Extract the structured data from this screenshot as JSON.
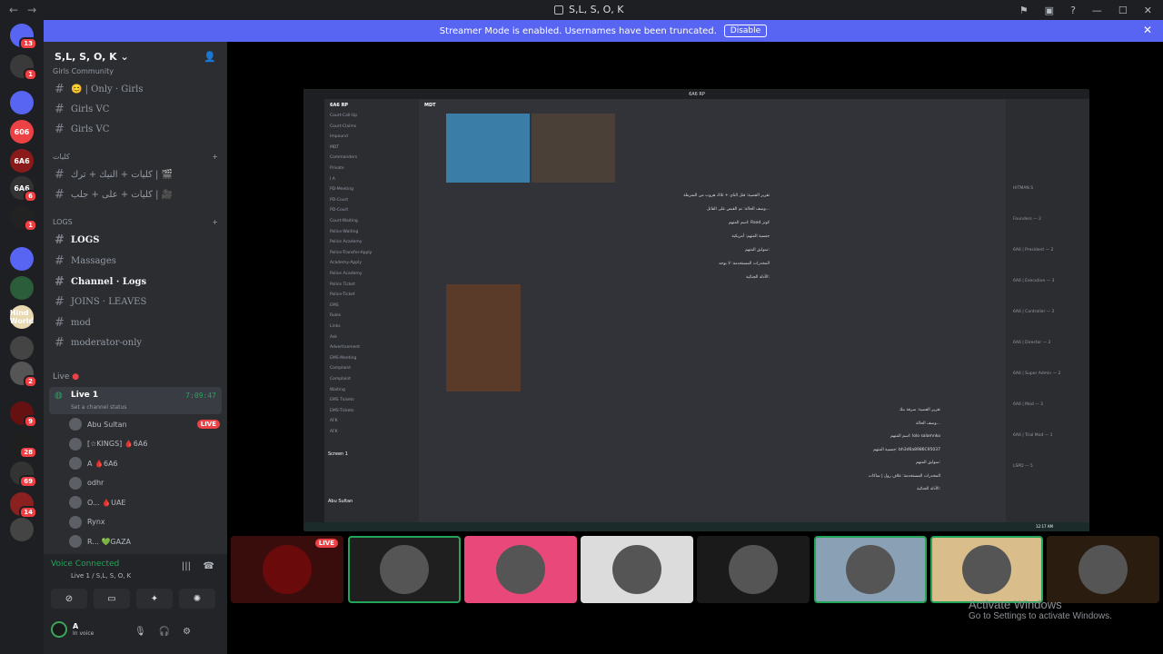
{
  "window": {
    "title": "S,L, S, O, K"
  },
  "banner": {
    "text": "Streamer Mode is enabled. Usernames have been truncated.",
    "disable_label": "Disable"
  },
  "servers": [
    {
      "label": "",
      "badge": "13",
      "color": "#5865f2"
    },
    {
      "label": "",
      "badge": "1",
      "color": "#3a3a3a"
    },
    {
      "label": "",
      "badge": "",
      "color": "#5865f2"
    },
    {
      "label": "606",
      "badge": "",
      "color": "#ed4245"
    },
    {
      "label": "6A6",
      "badge": "",
      "color": "#8b1a1a"
    },
    {
      "label": "6A6",
      "badge": "6",
      "color": "#333333"
    },
    {
      "label": "",
      "badge": "1",
      "color": "#222222"
    },
    {
      "label": "",
      "badge": "",
      "color": "#5865f2"
    },
    {
      "label": "",
      "badge": "",
      "color": "#2b5d3a"
    },
    {
      "label": "Hind World",
      "badge": "",
      "color": "#e8d9b0"
    },
    {
      "label": "",
      "badge": "",
      "color": "#444444"
    },
    {
      "label": "",
      "badge": "2",
      "color": "#555555"
    },
    {
      "label": "",
      "badge": "9",
      "color": "#661111"
    },
    {
      "label": "",
      "badge": "28",
      "color": "#1f1f1f"
    },
    {
      "label": "",
      "badge": "69",
      "color": "#333333"
    },
    {
      "label": "",
      "badge": "14",
      "color": "#8b2020"
    },
    {
      "label": "",
      "badge": "",
      "color": "#444444"
    }
  ],
  "sidebar": {
    "server_name": "S,L, S, O, K",
    "top_partial": "Girls Community",
    "channels_top": [
      {
        "name": "😊 | Only · Girls"
      },
      {
        "name": "Girls VC"
      },
      {
        "name": "Girls VC"
      }
    ],
    "cat1": "كليات",
    "channels_cat1": [
      {
        "name": "كليات + النيك + ترك | 🎬"
      },
      {
        "name": "كليات + على + جلب | 🎥"
      }
    ],
    "cat_logs": "LOGS",
    "logs": [
      {
        "name": "LOGS",
        "bold": true
      },
      {
        "name": "Massages",
        "bold": false
      },
      {
        "name": "Channel · Logs",
        "bold": true
      },
      {
        "name": "JOINS · LEAVES",
        "bold": false
      },
      {
        "name": "mod",
        "bold": false
      },
      {
        "name": "moderator-only",
        "bold": false
      }
    ],
    "cat_live": "Live",
    "voice_channel": {
      "name": "Live 1",
      "time": "7:09:47",
      "status": "Set a channel status"
    },
    "voice_users": [
      {
        "name": "Abu Sultan",
        "live": "LIVE"
      },
      {
        "name": "[☆KINGS]  🩸6A6",
        "live": ""
      },
      {
        "name": "A  🩸6A6",
        "live": ""
      },
      {
        "name": "odhr",
        "live": ""
      },
      {
        "name": "O...  🩸UAE",
        "live": ""
      },
      {
        "name": "Rynx",
        "live": ""
      },
      {
        "name": "R...  💚GAZA",
        "live": ""
      }
    ]
  },
  "voice_panel": {
    "status": "Voice Connected",
    "channel": "Live 1 / S,L, S, O, K"
  },
  "user": {
    "name": "A",
    "status": "In voice"
  },
  "stream": {
    "app_title": "6A6 RP",
    "server": "6A6 RP",
    "channel": "MDT",
    "channels": [
      "Court-Call-Up",
      "Court-Claims",
      "Impound",
      "MDT",
      "Commanders",
      "Private",
      "I A",
      "PD-Meeting",
      "PD-Court",
      "PD-Court",
      "Court-Waiting",
      "Police-Waiting",
      "Police Academy",
      "Police-Transfer-Apply",
      "Academy-Apply",
      "Police Academy",
      "Police Ticket",
      "Police-Ticket",
      "EMS",
      "Rules",
      "Links",
      "Ask",
      "Advertisement",
      "EMS-Meeting",
      "Complaint",
      "Complaint",
      "Waiting",
      "EMS Tickets",
      "EMS-Tickets",
      "AFK",
      "AFK"
    ],
    "chat_lines": [
      "تقرير القضية: قتل الناي + تلاك هروب من الشرطة",
      "وصف الحالة: تم القبض على القاتل...",
      "اسم المتهم: Raad كوتر",
      "جنسية المتهم: أمريكية",
      "سوابق المتهم:",
      "المخدرات المستخدمة: لا يوجد",
      "الأدلة الجنائية:"
    ],
    "chat_lines_2": [
      "تقرير القضية: سرقة بنك",
      "وصف الحالة...",
      "اسم المتهم: lolo salamnko",
      "جنسية المتهم: bh3d6a8986C95037",
      "سوابق المتهم:",
      "المخدرات المستخدمة: غلاف رول | شاكات",
      "الأدلة الجنائية:"
    ],
    "members": [
      "HITMAN.S",
      "Founders — 2",
      "6A6 | President — 2",
      "6A6 | Executive — 3",
      "6A6 | Controller — 2",
      "6A6 | Director — 2",
      "6A6 | Super Admin — 2",
      "6A6 | Mod — 3",
      "6A6 | Trial Mod — 1",
      "LSPD — 5"
    ],
    "screen_label": "Screen 1",
    "stream_user": "Abu Sultan",
    "taskbar_time": "12:17 AM"
  },
  "tiles": [
    {
      "name": "stream",
      "live": "LIVE",
      "bg": "#3a0d0d"
    },
    {
      "name": "user-1",
      "live": "",
      "bg": "#1f1f1f"
    },
    {
      "name": "user-2",
      "live": "",
      "bg": "#e8487a"
    },
    {
      "name": "user-3",
      "live": "",
      "bg": "#dcdcdc"
    },
    {
      "name": "user-4",
      "live": "",
      "bg": "#1a1a1a"
    },
    {
      "name": "user-5",
      "live": "",
      "bg": "#8aa0b4"
    },
    {
      "name": "user-6",
      "live": "",
      "bg": "#d9bd8b"
    },
    {
      "name": "user-7",
      "live": "",
      "bg": "#2a1d10"
    }
  ],
  "activate": {
    "title": "Activate Windows",
    "sub": "Go to Settings to activate Windows."
  }
}
